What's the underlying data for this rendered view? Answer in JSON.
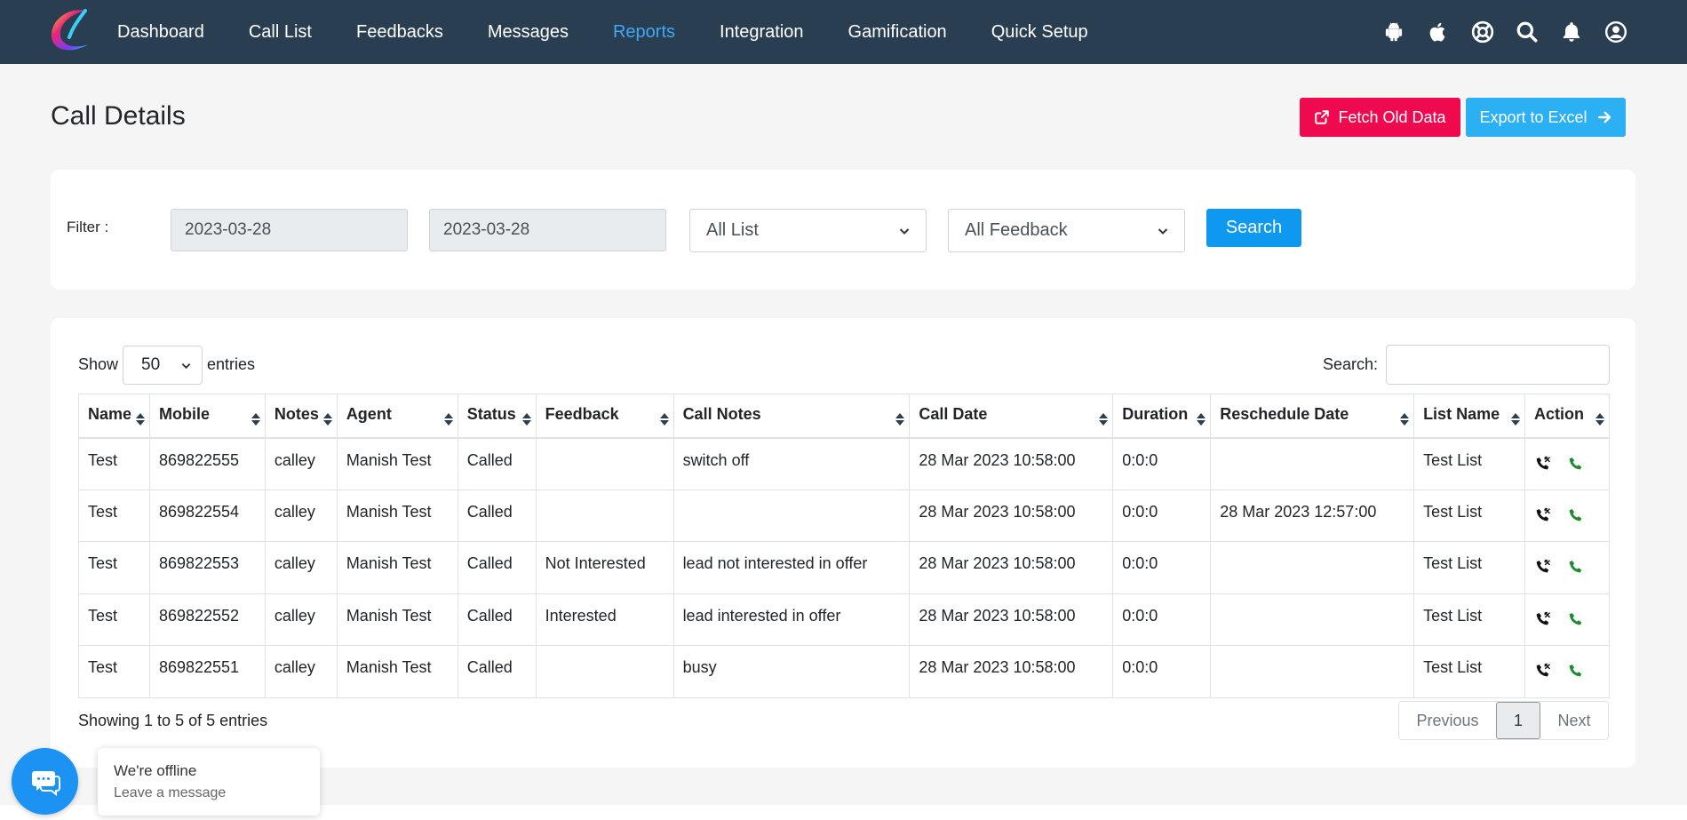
{
  "nav": {
    "items": [
      "Dashboard",
      "Call List",
      "Feedbacks",
      "Messages",
      "Reports",
      "Integration",
      "Gamification",
      "Quick Setup"
    ],
    "active": "Reports",
    "icons": [
      "android-icon",
      "apple-icon",
      "lifebuoy-icon",
      "search-icon",
      "bell-icon",
      "user-circle-icon"
    ]
  },
  "page": {
    "title": "Call Details",
    "fetch_label": "Fetch Old Data",
    "export_label": "Export to Excel"
  },
  "filter": {
    "label": "Filter :",
    "date_from": "2023-03-28",
    "date_to": "2023-03-28",
    "list_select": "All List",
    "feedback_select": "All Feedback",
    "search_label": "Search"
  },
  "table_controls": {
    "show_label": "Show",
    "length_value": "50",
    "entries_label": "entries",
    "search_label": "Search:"
  },
  "table": {
    "columns": [
      "Name",
      "Mobile",
      "Notes",
      "Agent",
      "Status",
      "Feedback",
      "Call Notes",
      "Call Date",
      "Duration",
      "Reschedule Date",
      "List Name",
      "Action"
    ],
    "rows": [
      [
        "Test",
        "869822555",
        "calley",
        "Manish Test",
        "Called",
        "",
        "switch off",
        "28 Mar 2023 10:58:00",
        "0:0:0",
        "",
        "Test List"
      ],
      [
        "Test",
        "869822554",
        "calley",
        "Manish Test",
        "Called",
        "",
        "",
        "28 Mar 2023 10:58:00",
        "0:0:0",
        "28 Mar 2023 12:57:00",
        "Test List"
      ],
      [
        "Test",
        "869822553",
        "calley",
        "Manish Test",
        "Called",
        "Not Interested",
        "lead not interested in offer",
        "28 Mar 2023 10:58:00",
        "0:0:0",
        "",
        "Test List"
      ],
      [
        "Test",
        "869822552",
        "calley",
        "Manish Test",
        "Called",
        "Interested",
        "lead interested in offer",
        "28 Mar 2023 10:58:00",
        "0:0:0",
        "",
        "Test List"
      ],
      [
        "Test",
        "869822551",
        "calley",
        "Manish Test",
        "Called",
        "",
        "busy",
        "28 Mar 2023 10:58:00",
        "0:0:0",
        "",
        "Test List"
      ]
    ]
  },
  "footer": {
    "info": "Showing 1 to 5 of 5 entries",
    "prev": "Previous",
    "page": "1",
    "next": "Next"
  },
  "chat": {
    "title": "We're offline",
    "subtitle": "Leave a message"
  },
  "colors": {
    "navbar": "#2a3e52",
    "active_nav": "#3fa9f5",
    "fetch_button": "#ef0a50",
    "export_button": "#2ab0f3",
    "search_button": "#0d99f0",
    "chat_button": "#1c92f2"
  }
}
